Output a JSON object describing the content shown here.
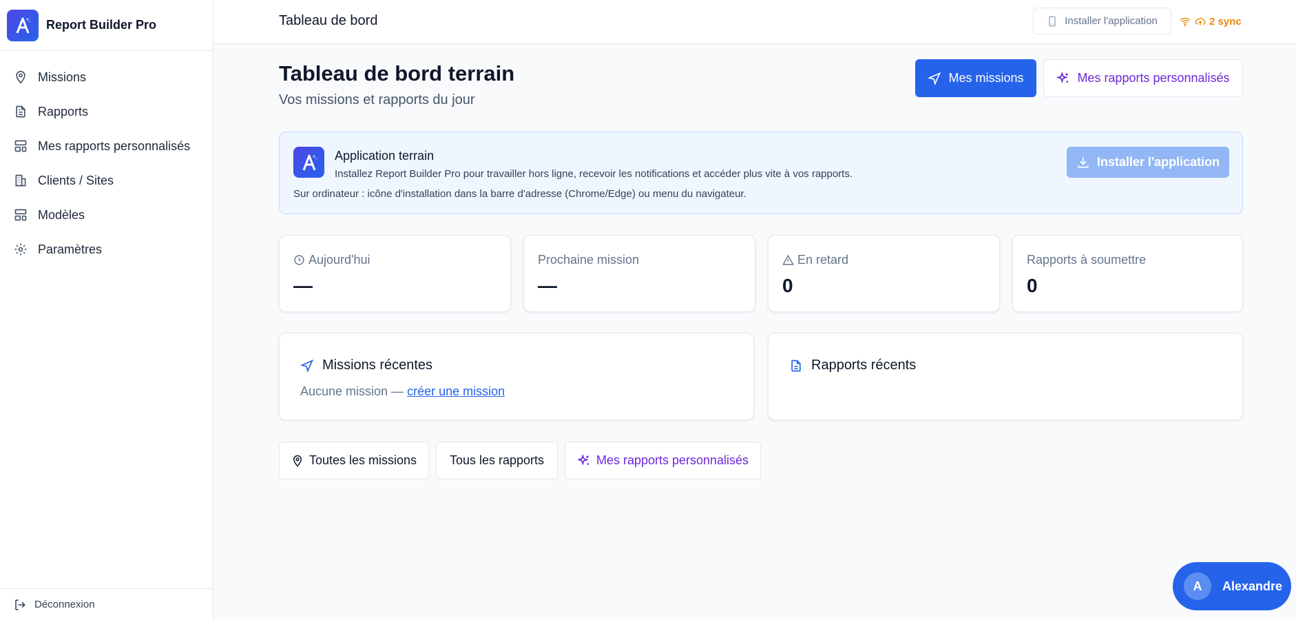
{
  "app": {
    "name": "Report Builder Pro",
    "logo_letter": "A"
  },
  "colors": {
    "primary": "#2563eb",
    "purple": "#6d28d9",
    "sync": "#ea8a0b"
  },
  "sidebar": {
    "items": [
      {
        "label": "Missions",
        "icon": "map-pin-icon"
      },
      {
        "label": "Rapports",
        "icon": "file-text-icon"
      },
      {
        "label": "Mes rapports personnalisés",
        "icon": "layout-icon"
      },
      {
        "label": "Clients / Sites",
        "icon": "building-icon"
      },
      {
        "label": "Modèles",
        "icon": "template-icon"
      },
      {
        "label": "Paramètres",
        "icon": "gear-icon"
      }
    ],
    "logout_label": "Déconnexion"
  },
  "header": {
    "title": "Tableau de bord",
    "install_label": "Installer l'application",
    "sync_label": "2 sync"
  },
  "main": {
    "title": "Tableau de bord terrain",
    "subtitle": "Vos missions et rapports du jour",
    "primary_button": "Mes missions",
    "secondary_button": "Mes rapports personnalisés"
  },
  "banner": {
    "title": "Application terrain",
    "description": "Installez Report Builder Pro pour travailler hors ligne, recevoir les notifications et accéder plus vite à vos rapports.",
    "hint": "Sur ordinateur : icône d'installation dans la barre d'adresse (Chrome/Edge) ou menu du navigateur.",
    "button": "Installer l'application"
  },
  "stats": [
    {
      "label": "Aujourd'hui",
      "value": "—"
    },
    {
      "label": "Prochaine mission",
      "value": "—"
    },
    {
      "label": "En retard",
      "value": "0"
    },
    {
      "label": "Rapports à soumettre",
      "value": "0"
    }
  ],
  "panels": {
    "missions": {
      "title": "Missions récentes",
      "empty_text": "Aucune mission — ",
      "empty_link": "créer une mission"
    },
    "reports": {
      "title": "Rapports récents"
    }
  },
  "quick_actions": {
    "all_missions": "Toutes les missions",
    "all_reports": "Tous les rapports",
    "custom_reports": "Mes rapports personnalisés"
  },
  "user": {
    "initial": "A",
    "name": "Alexandre"
  }
}
